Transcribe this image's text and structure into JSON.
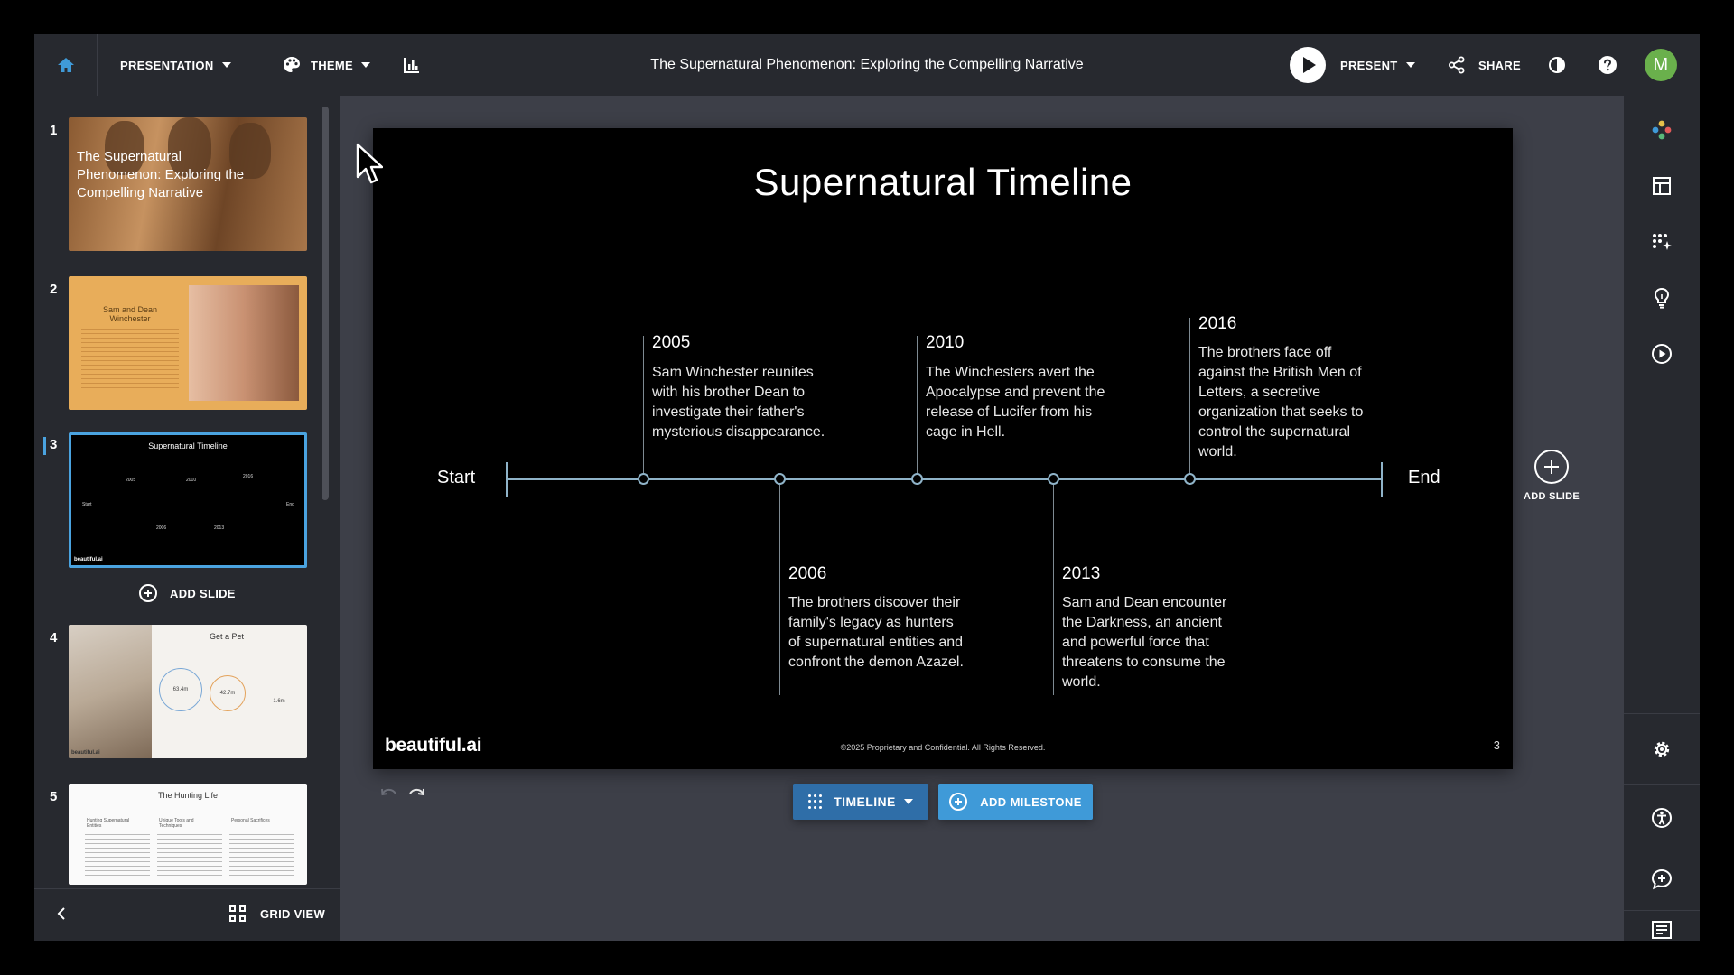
{
  "topbar": {
    "presentation_label": "PRESENTATION",
    "theme_label": "THEME",
    "doc_title": "The Supernatural Phenomenon: Exploring the Compelling Narrative",
    "present_label": "PRESENT",
    "share_label": "SHARE",
    "avatar_initial": "M"
  },
  "sidebar": {
    "slides": [
      {
        "number": "1",
        "title": "The Supernatural Phenomenon: Exploring the Compelling Narrative"
      },
      {
        "number": "2",
        "title": "Sam and Dean Winchester"
      },
      {
        "number": "3",
        "title": "Supernatural Timeline"
      },
      {
        "number": "4",
        "title": "Get a Pet"
      },
      {
        "number": "5",
        "title": "The Hunting Life"
      }
    ],
    "thumb3": {
      "years": [
        "2005",
        "2010",
        "2016",
        "2006",
        "2013"
      ],
      "start": "Start",
      "end": "End",
      "logo": "beautiful.ai"
    },
    "thumb4": {
      "stat1": "63.4m",
      "stat2": "42.7m",
      "stat3": "1.6m",
      "logo": "beautiful.ai"
    },
    "thumb5": {
      "bullets": [
        "Hunting Supernatural Entities",
        "Unique Tools and Techniques",
        "Personal Sacrifices"
      ]
    },
    "add_slide_label": "ADD SLIDE",
    "grid_view_label": "GRID VIEW"
  },
  "slide": {
    "title": "Supernatural Timeline",
    "start_label": "Start",
    "end_label": "End",
    "milestones": [
      {
        "year": "2005",
        "text": "Sam Winchester reunites with his brother Dean to investigate their father's mysterious disappearance."
      },
      {
        "year": "2006",
        "text": "The brothers discover their family's legacy as hunters of supernatural entities and confront the demon Azazel."
      },
      {
        "year": "2010",
        "text": "The Winchesters avert the Apocalypse and prevent the release of Lucifer from his cage in Hell."
      },
      {
        "year": "2013",
        "text": "Sam and Dean encounter the Darkness, an ancient and powerful force that threatens to consume the world."
      },
      {
        "year": "2016",
        "text": "The brothers face off against the British Men of Letters, a secretive organization that seeks to control the supernatural world."
      }
    ],
    "logo": "beautiful.ai",
    "copyright": "©2025 Proprietary and Confidential. All Rights Reserved.",
    "page_number": "3"
  },
  "canvas_toolbar": {
    "timeline_label": "TIMELINE",
    "add_milestone_label": "ADD MILESTONE"
  },
  "right": {
    "add_slide_label": "ADD SLIDE"
  },
  "colors": {
    "selection": "#4aa3e0",
    "timeline_button": "#2f6ea8",
    "add_milestone_button": "#3f9ad8",
    "avatar": "#6ab04c"
  }
}
